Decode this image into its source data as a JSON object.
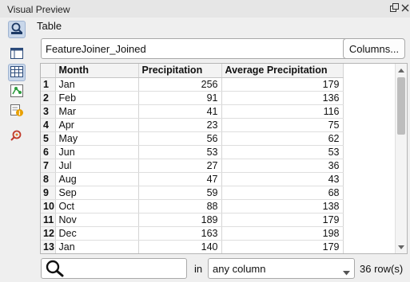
{
  "window": {
    "title": "Visual Preview"
  },
  "toolbar": {
    "items": [
      {
        "icon": "inspect-icon",
        "active": true
      },
      {
        "icon": "panel-view-icon",
        "active": false
      },
      {
        "icon": "table-view-icon",
        "active": true
      },
      {
        "icon": "graphics-view-icon",
        "active": false
      },
      {
        "icon": "feature-info-icon",
        "active": false
      },
      {
        "icon": "search-zoom-icon",
        "active": false
      }
    ]
  },
  "main": {
    "section_title": "Table",
    "dataset": {
      "selected": "FeatureJoiner_Joined"
    },
    "columns_button": "Columns...",
    "table": {
      "headers": [
        "Month",
        "Precipitation",
        "Average Precipitation"
      ],
      "rows": [
        {
          "n": "1",
          "month": "Jan",
          "precip": "256",
          "avg": "179"
        },
        {
          "n": "2",
          "month": "Feb",
          "precip": "91",
          "avg": "136"
        },
        {
          "n": "3",
          "month": "Mar",
          "precip": "41",
          "avg": "116"
        },
        {
          "n": "4",
          "month": "Apr",
          "precip": "23",
          "avg": "75"
        },
        {
          "n": "5",
          "month": "May",
          "precip": "56",
          "avg": "62"
        },
        {
          "n": "6",
          "month": "Jun",
          "precip": "53",
          "avg": "53"
        },
        {
          "n": "7",
          "month": "Jul",
          "precip": "27",
          "avg": "36"
        },
        {
          "n": "8",
          "month": "Aug",
          "precip": "47",
          "avg": "43"
        },
        {
          "n": "9",
          "month": "Sep",
          "precip": "59",
          "avg": "68"
        },
        {
          "n": "10",
          "month": "Oct",
          "precip": "88",
          "avg": "138"
        },
        {
          "n": "11",
          "month": "Nov",
          "precip": "189",
          "avg": "179"
        },
        {
          "n": "12",
          "month": "Dec",
          "precip": "163",
          "avg": "198"
        },
        {
          "n": "13",
          "month": "Jan",
          "precip": "140",
          "avg": "179"
        }
      ]
    },
    "search": {
      "value": "",
      "placeholder": ""
    },
    "in_label": "in",
    "column_filter": {
      "selected": "any column"
    },
    "row_count": "36 row(s)"
  },
  "colors": {
    "active_tool_bg": "#c9d7ea",
    "panel_bg": "#efefef"
  }
}
